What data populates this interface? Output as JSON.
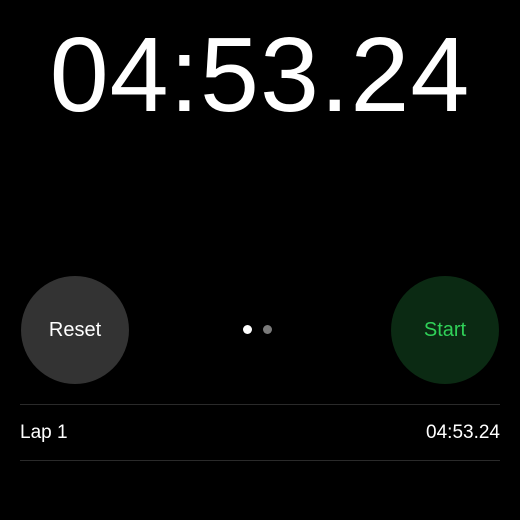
{
  "timer": {
    "display": "04:53.24"
  },
  "controls": {
    "reset_label": "Reset",
    "start_label": "Start",
    "page_indicator": {
      "pages": 2,
      "current_page": 1
    }
  },
  "laps": [
    {
      "label": "Lap 1",
      "time": "04:53.24"
    }
  ],
  "colors": {
    "background": "#000000",
    "reset_button": "#333333",
    "start_button": "#0b2a13",
    "start_text": "#30d158",
    "divider": "#2a2a2a"
  }
}
